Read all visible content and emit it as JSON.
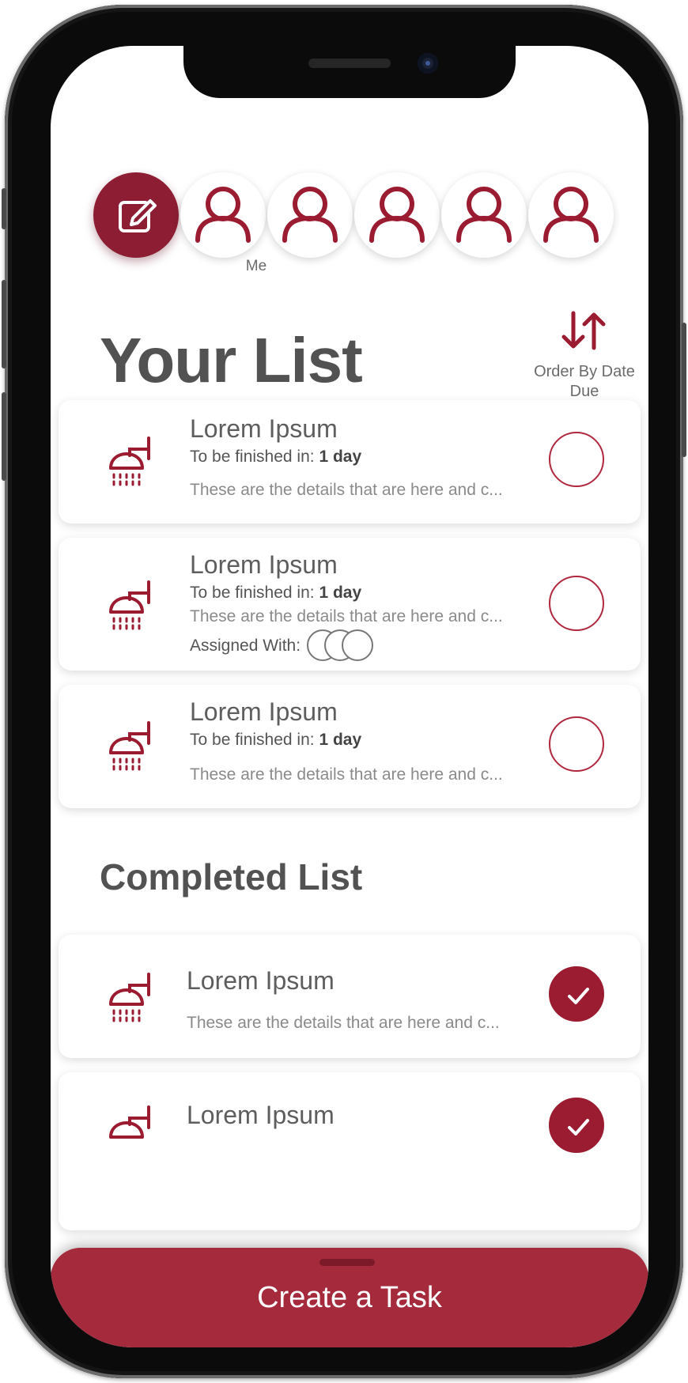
{
  "theme": {
    "accent": "#9b1b30",
    "sheet": "#a52a3c",
    "text_dark": "#525252",
    "text_muted": "#8a8a8a"
  },
  "people": {
    "edit_icon": "edit-pencil-icon",
    "avatar_icon": "user-icon",
    "me_label": "Me"
  },
  "header": {
    "title": "Your List",
    "sort_icon": "sort-arrows-icon",
    "sort_label": "Order By Date Due"
  },
  "tasks": [
    {
      "title": "Lorem Ipsum",
      "due_prefix": "To be finished in:",
      "due_value": "1 day",
      "details": "These are the details that are here and c...",
      "icon": "shower-icon",
      "completed": false
    },
    {
      "title": "Lorem Ipsum",
      "due_prefix": "To be finished in:",
      "due_value": "1 day",
      "details": "These are the details that are here and c...",
      "assigned_label": "Assigned With:",
      "icon": "shower-icon",
      "completed": false
    },
    {
      "title": "Lorem Ipsum",
      "due_prefix": "To be finished in:",
      "due_value": "1 day",
      "details": "These are the details that are here and c...",
      "icon": "shower-icon",
      "completed": false
    }
  ],
  "completed_section": {
    "title": "Completed List",
    "items": [
      {
        "title": "Lorem Ipsum",
        "details": "These are the details that are here and c...",
        "icon": "shower-icon",
        "completed": true
      },
      {
        "title": "Lorem Ipsum",
        "icon": "shower-icon",
        "completed": true
      }
    ]
  },
  "bottom_sheet": {
    "create_label": "Create a Task"
  }
}
